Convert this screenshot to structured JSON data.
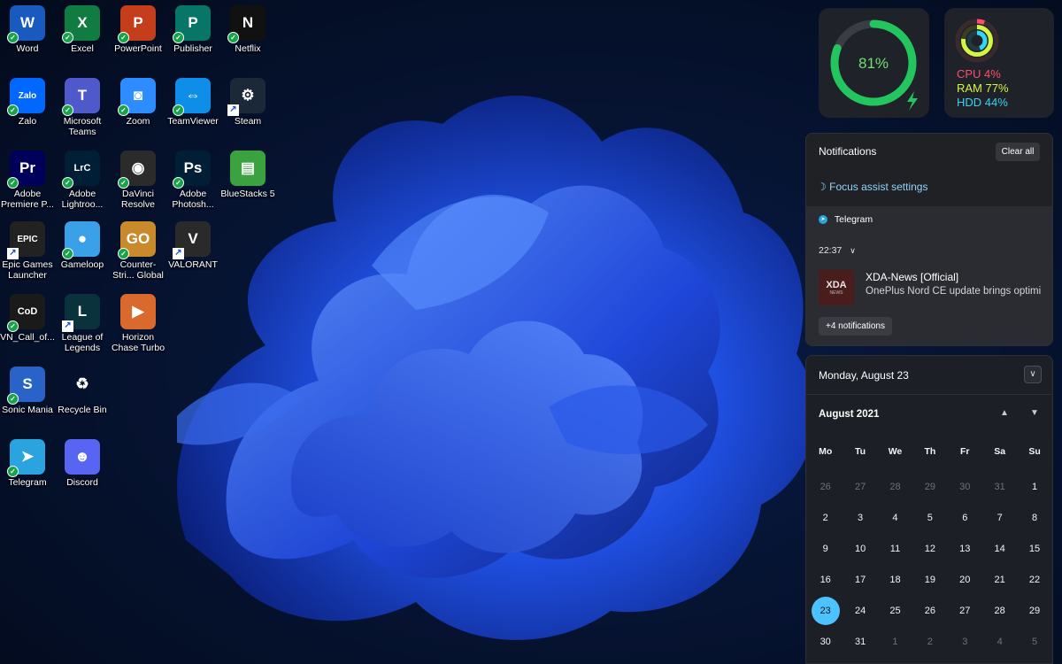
{
  "desktop": {
    "icons": [
      {
        "label": "Word",
        "glyph": "W",
        "icon": "word-icon",
        "color": "#185abd",
        "badge": "synced"
      },
      {
        "label": "Excel",
        "glyph": "X",
        "icon": "excel-icon",
        "color": "#107c41",
        "badge": "synced"
      },
      {
        "label": "PowerPoint",
        "glyph": "P",
        "icon": "powerpoint-icon",
        "color": "#c43e1c",
        "badge": "synced"
      },
      {
        "label": "Publisher",
        "glyph": "P",
        "icon": "publisher-icon",
        "color": "#077568",
        "badge": "synced"
      },
      {
        "label": "Netflix",
        "glyph": "N",
        "icon": "netflix-icon",
        "color": "#111111",
        "badge": "synced"
      },
      {
        "label": "Zalo",
        "glyph": "Zalo",
        "icon": "zalo-icon",
        "color": "#0068ff",
        "badge": "synced"
      },
      {
        "label": "Microsoft Teams",
        "glyph": "T",
        "icon": "teams-icon",
        "color": "#5059c9",
        "badge": "synced"
      },
      {
        "label": "Zoom",
        "glyph": "◙",
        "icon": "zoom-icon",
        "color": "#2d8cff",
        "badge": "synced"
      },
      {
        "label": "TeamViewer",
        "glyph": "⇔",
        "icon": "teamviewer-icon",
        "color": "#0e8ee9",
        "badge": "synced"
      },
      {
        "label": "Steam",
        "glyph": "⚙",
        "icon": "steam-icon",
        "color": "#1b2838",
        "badge": "shortcut"
      },
      {
        "label": "Adobe Premiere P...",
        "glyph": "Pr",
        "icon": "premiere-icon",
        "color": "#00005b",
        "badge": "synced"
      },
      {
        "label": "Adobe Lightroo...",
        "glyph": "LrC",
        "icon": "lightroom-icon",
        "color": "#001e36",
        "badge": "synced"
      },
      {
        "label": "DaVinci Resolve",
        "glyph": "◉",
        "icon": "davinci-icon",
        "color": "#2b2b2b",
        "badge": "synced"
      },
      {
        "label": "Adobe Photosh...",
        "glyph": "Ps",
        "icon": "photoshop-icon",
        "color": "#001e36",
        "badge": "synced"
      },
      {
        "label": "BlueStacks 5",
        "glyph": "▤",
        "icon": "bluestacks-icon",
        "color": "#3aa340",
        "badge": "none"
      },
      {
        "label": "Epic Games Launcher",
        "glyph": "EPIC",
        "icon": "epic-games-icon",
        "color": "#222222",
        "badge": "shortcut"
      },
      {
        "label": "Gameloop",
        "glyph": "●",
        "icon": "gameloop-icon",
        "color": "#3aa0e8",
        "badge": "synced"
      },
      {
        "label": "Counter-Stri... Global Offe...",
        "glyph": "GO",
        "icon": "csgo-icon",
        "color": "#c88a2a",
        "badge": "synced"
      },
      {
        "label": "VALORANT",
        "glyph": "V",
        "icon": "valorant-icon",
        "color": "#2a2a2a",
        "badge": "shortcut"
      },
      {
        "label": "",
        "glyph": "",
        "icon": "empty",
        "color": "",
        "badge": "none"
      },
      {
        "label": "VN_Call_of...",
        "glyph": "CoD",
        "icon": "call-of-duty-icon",
        "color": "#1a1a1a",
        "badge": "synced"
      },
      {
        "label": "League of Legends",
        "glyph": "L",
        "icon": "league-icon",
        "color": "#0a323c",
        "badge": "shortcut"
      },
      {
        "label": "Horizon Chase Turbo",
        "glyph": "▶",
        "icon": "horizon-chase-icon",
        "color": "#d9692c",
        "badge": "none"
      },
      {
        "label": "",
        "glyph": "",
        "icon": "empty",
        "color": "",
        "badge": "none"
      },
      {
        "label": "",
        "glyph": "",
        "icon": "empty",
        "color": "",
        "badge": "none"
      },
      {
        "label": "Sonic Mania",
        "glyph": "S",
        "icon": "sonic-icon",
        "color": "#2a63c8",
        "badge": "synced"
      },
      {
        "label": "Recycle Bin",
        "glyph": "♻",
        "icon": "recycle-bin-icon",
        "color": "transparent",
        "badge": "none"
      },
      {
        "label": "",
        "glyph": "",
        "icon": "empty",
        "color": "",
        "badge": "none"
      },
      {
        "label": "",
        "glyph": "",
        "icon": "empty",
        "color": "",
        "badge": "none"
      },
      {
        "label": "",
        "glyph": "",
        "icon": "empty",
        "color": "",
        "badge": "none"
      },
      {
        "label": "Telegram",
        "glyph": "➤",
        "icon": "telegram-icon",
        "color": "#2aa3df",
        "badge": "synced"
      },
      {
        "label": "Discord",
        "glyph": "☻",
        "icon": "discord-icon",
        "color": "#5865f2",
        "badge": "none"
      }
    ]
  },
  "battery_widget": {
    "percent": 81,
    "percent_text": "81%",
    "ring_color": "#22c55e",
    "icon": "charging-bolt-icon"
  },
  "system_widget": {
    "icon": "activity-rings-icon",
    "cpu": {
      "text": "CPU 4%",
      "value": 4,
      "color": "#ff4d6d"
    },
    "ram": {
      "text": "RAM 77%",
      "value": 77,
      "color": "#d4f542"
    },
    "hdd": {
      "text": "HDD 44%",
      "value": 44,
      "color": "#34d4f5"
    }
  },
  "notifications": {
    "title": "Notifications",
    "clear_all_label": "Clear all",
    "focus_assist_label": "Focus assist settings",
    "group_app": "Telegram",
    "time": "22:37",
    "item": {
      "sender": "XDA-News [Official]",
      "body": "OnePlus Nord CE update brings optimi",
      "thumb_text": "XDA",
      "thumb_sub": "NEWS"
    },
    "more_label": "+4 notifications"
  },
  "calendar": {
    "date_header": "Monday, August 23",
    "month_label": "August 2021",
    "weekdays": [
      "Mo",
      "Tu",
      "We",
      "Th",
      "Fr",
      "Sa",
      "Su"
    ],
    "weeks": [
      [
        "26",
        "27",
        "28",
        "29",
        "30",
        "31",
        "1"
      ],
      [
        "2",
        "3",
        "4",
        "5",
        "6",
        "7",
        "8"
      ],
      [
        "9",
        "10",
        "11",
        "12",
        "13",
        "14",
        "15"
      ],
      [
        "16",
        "17",
        "18",
        "19",
        "20",
        "21",
        "22"
      ],
      [
        "23",
        "24",
        "25",
        "26",
        "27",
        "28",
        "29"
      ],
      [
        "30",
        "31",
        "1",
        "2",
        "3",
        "4",
        "5"
      ]
    ],
    "today": "23",
    "accent": "#4cc2ff"
  }
}
